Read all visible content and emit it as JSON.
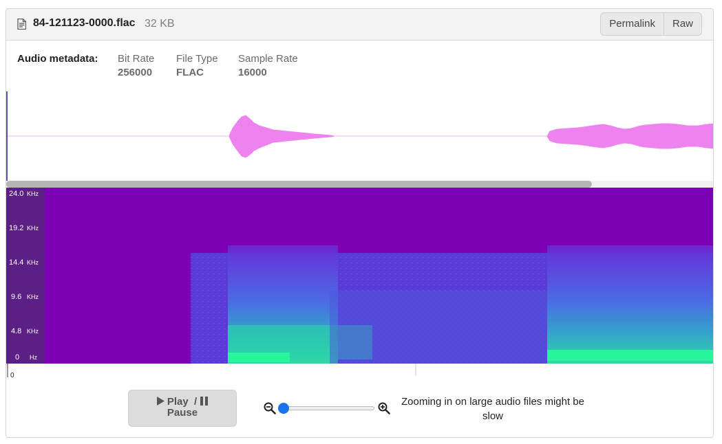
{
  "file": {
    "name": "84-121123-0000.flac",
    "size": "32 KB",
    "icon": "file-text-icon"
  },
  "actions": {
    "permalink": "Permalink",
    "raw": "Raw"
  },
  "metadata": {
    "label": "Audio metadata:",
    "fields": [
      {
        "key": "Bit Rate",
        "value": "256000"
      },
      {
        "key": "File Type",
        "value": "FLAC"
      },
      {
        "key": "Sample Rate",
        "value": "16000"
      }
    ]
  },
  "waveform": {
    "color": "#ee82ee"
  },
  "spectrogram": {
    "freq_labels": [
      {
        "value": "24.0",
        "unit": "KHz"
      },
      {
        "value": "19.2",
        "unit": "KHz"
      },
      {
        "value": "14.4",
        "unit": "KHz"
      },
      {
        "value": "9.6",
        "unit": "KHz"
      },
      {
        "value": "4.8",
        "unit": "KHz"
      },
      {
        "value": "0",
        "unit": "Hz"
      }
    ],
    "background_color": "#7b00b4",
    "label_bg_color": "#5b1f86"
  },
  "timeline": {
    "start": "0"
  },
  "controls": {
    "play": "Play",
    "separator": "/",
    "pause": "Pause",
    "zoom_level": 0,
    "zoom_note": "Zooming in on large audio files might be slow"
  }
}
